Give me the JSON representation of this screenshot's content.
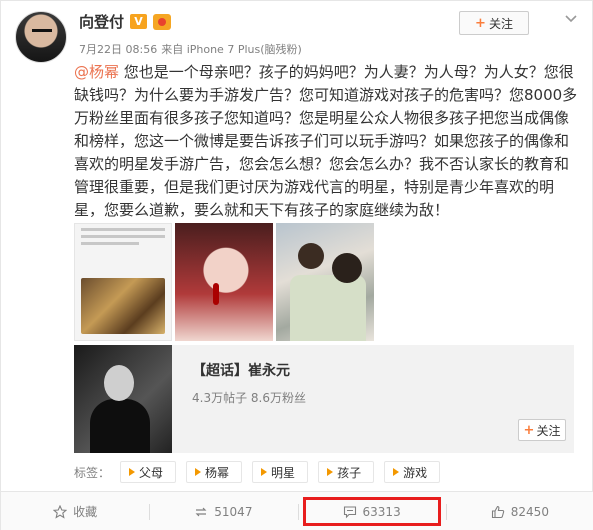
{
  "post": {
    "author": {
      "name": "向登付",
      "verified_badge": "V",
      "time": "7月22日 08:56",
      "source": "来自 iPhone 7 Plus(脑残粉)"
    },
    "follow_label": "关注",
    "text_mention": "@杨幂",
    "text_body": " 您也是一个母亲吧？孩子的妈妈吧？为人妻？为人母？为人女？您很缺钱吗？为什么要为手游发广告？您可知道游戏对孩子的危害吗？您8000多万粉丝里面有很多孩子您知道吗？您是明星公众人物很多孩子把您当成偶像和榜样，您这一个微博是要告诉孩子们可以玩手游吗？如果您孩子的偶像和喜欢的明星发手游广告，您会怎么想？您会怎么办？我不否认家长的教育和管理很重要，但是我们更讨厌为游戏代言的明星，特别是青少年喜欢的明星，您要么道歉，要么就和天下有孩子的家庭继续为敌！",
    "topic_card": {
      "title": "【超话】崔永元",
      "stats": "4.3万帖子 8.6万粉丝",
      "follow_label": "关注"
    },
    "tags_label": "标签：",
    "tags": [
      "父母",
      "杨幂",
      "明星",
      "孩子",
      "游戏"
    ],
    "actions": {
      "favorite": "收藏",
      "repost": "51047",
      "comment": "63313",
      "like": "82450"
    }
  },
  "colors": {
    "accent": "#eb7350",
    "highlight_box": "#e81d1d",
    "tag_marker": "#f39800"
  }
}
